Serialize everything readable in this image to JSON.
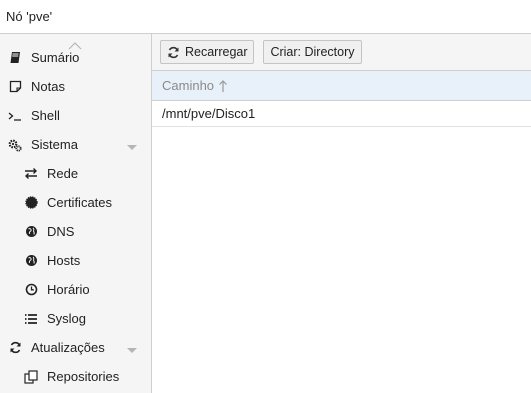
{
  "window": {
    "title": "Nó 'pve'"
  },
  "sidebar": {
    "items": [
      {
        "label": "Sumário",
        "icon": "book-icon"
      },
      {
        "label": "Notas",
        "icon": "note-icon"
      },
      {
        "label": "Shell",
        "icon": "terminal-icon"
      },
      {
        "label": "Sistema",
        "icon": "cogs-icon",
        "expanded": true
      },
      {
        "label": "Rede",
        "icon": "exchange-icon"
      },
      {
        "label": "Certificates",
        "icon": "certificate-icon"
      },
      {
        "label": "DNS",
        "icon": "globe-icon"
      },
      {
        "label": "Hosts",
        "icon": "globe-icon"
      },
      {
        "label": "Horário",
        "icon": "clock-icon"
      },
      {
        "label": "Syslog",
        "icon": "list-icon"
      },
      {
        "label": "Atualizações",
        "icon": "refresh-icon",
        "expanded": true
      },
      {
        "label": "Repositories",
        "icon": "files-icon"
      }
    ]
  },
  "toolbar": {
    "reload_label": "Recarregar",
    "create_label": "Criar: Directory"
  },
  "grid": {
    "columns": [
      {
        "label": "Caminho",
        "sort": "ascending"
      }
    ],
    "rows": [
      {
        "path": "/mnt/pve/Disco1"
      }
    ]
  },
  "colors": {
    "header_bg": "#e8f1f9",
    "sidebar_bg": "#f5f5f5",
    "border": "#cfcfcf"
  }
}
